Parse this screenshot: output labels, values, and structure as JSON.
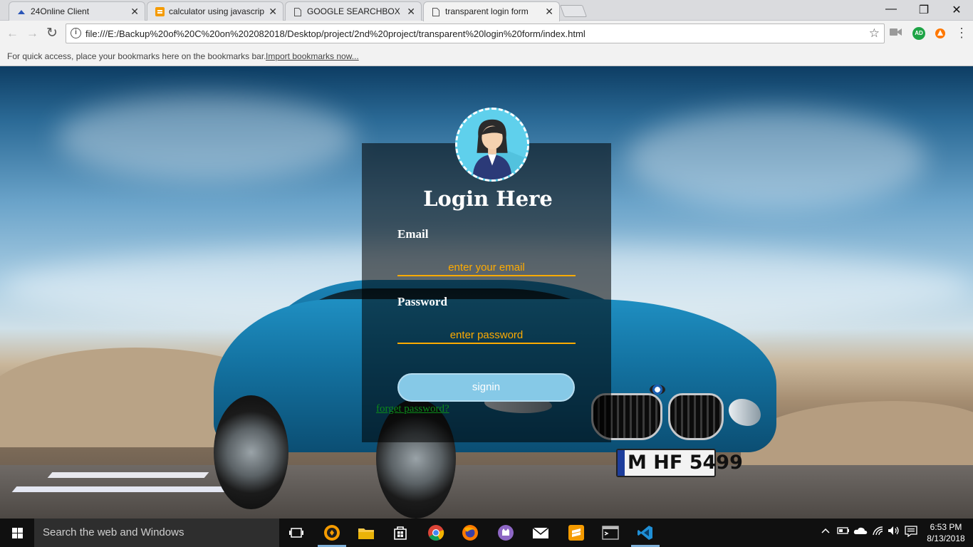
{
  "browser": {
    "tabs": [
      {
        "title": "24Online Client",
        "icon": "globe-icon"
      },
      {
        "title": "calculator using javascrip",
        "icon": "sublime-icon"
      },
      {
        "title": "GOOGLE SEARCHBOX",
        "icon": "page-icon"
      },
      {
        "title": "transparent login form",
        "icon": "page-icon"
      }
    ],
    "close_glyph": "✕",
    "window_controls": {
      "minimize": "—",
      "maximize": "❐",
      "close": "✕"
    },
    "nav": {
      "back": "←",
      "forward": "→",
      "reload": "↻"
    },
    "url": "file:///E:/Backup%20of%20C%20on%202082018/Desktop/project/2nd%20project/transparent%20login%20form/index.html",
    "info_glyph": "i",
    "star": "☆",
    "extensions": [
      "video-icon",
      "ad-block-icon",
      "avast-icon"
    ],
    "ad_label": "AD",
    "menu": "⋮",
    "bookmarks_hint": "For quick access, place your bookmarks here on the bookmarks bar.",
    "import_link": "Import bookmarks now..."
  },
  "page": {
    "title": "Login Here",
    "email_label": "Email",
    "email_placeholder": "enter your email",
    "password_label": "Password",
    "password_placeholder": "enter password",
    "signin_label": "signin",
    "forget_link": "forget password?",
    "plate_text": "M HF 5499"
  },
  "taskbar": {
    "search_placeholder": "Search the web and Windows",
    "apps": [
      "task-view-icon",
      "brave-icon",
      "file-explorer-icon",
      "store-icon",
      "chrome-icon",
      "firefox-icon",
      "app-icon",
      "mail-icon",
      "sublime-icon",
      "terminal-icon",
      "vscode-icon"
    ],
    "time": "6:53 PM",
    "date": "8/13/2018"
  },
  "colors": {
    "accent_input": "#ffab00",
    "button": "#86c9e7",
    "link": "#0b8a1a"
  }
}
